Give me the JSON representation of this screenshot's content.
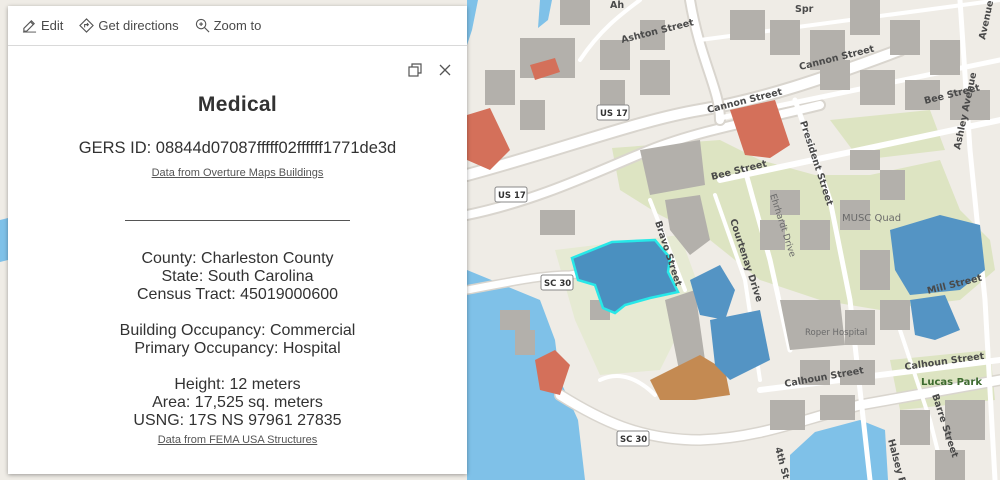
{
  "toolbar": {
    "edit_label": "Edit",
    "directions_label": "Get directions",
    "zoom_label": "Zoom to"
  },
  "popup": {
    "title": "Medical",
    "gers_id": "GERS ID: 08844d07087fffff02ffffff1771de3d",
    "overture_link": "Data from Overture Maps Buildings",
    "county": "County: Charleston County",
    "state": "State: South Carolina",
    "census_tract": "Census Tract: 45019000600",
    "building_occupancy": "Building Occupancy: Commercial",
    "primary_occupancy": "Primary Occupancy: Hospital",
    "height": "Height: 12 meters",
    "area": "Area: 17,525 sq. meters",
    "usng": "USNG: 17S NS 97961 27835",
    "fema_link": "Data from FEMA USA Structures"
  },
  "map": {
    "streets": {
      "ashton": "Ashton Street",
      "cannon_1": "Cannon Street",
      "cannon_2": "Cannon Street",
      "bee_1": "Bee Street",
      "bee_2": "Bee Street",
      "president": "President Street",
      "ehrhardt": "Ehrhardt Drive",
      "courtenay": "Courtenay Drive",
      "bravo": "Bravo Street",
      "ashley": "Ashley Avenue",
      "mill": "Mill Street",
      "calhoun_1": "Calhoun Street",
      "calhoun_2": "Calhoun Street",
      "barre": "Barre Street",
      "halsey": "Halsey B",
      "fourth": "4th St",
      "spr": "Spr",
      "avenue": "Avenue",
      "ah": "Ah"
    },
    "shields": {
      "us17_a": "US 17",
      "us17_b": "US 17",
      "sc30_a": "SC 30",
      "sc30_b": "SC 30"
    },
    "places": {
      "musc_quad": "MUSC Quad",
      "roper": "Roper Hospital",
      "lucas_park": "Lucas Park"
    },
    "colors": {
      "selected_fill": "#4a90c0",
      "selected_outline": "#27e8e8",
      "commercial_fill": "#5494c4",
      "brick_fill": "#d4705a",
      "copper_fill": "#c48a52",
      "water": "#7fc1e8",
      "park": "#dde4c2"
    }
  }
}
